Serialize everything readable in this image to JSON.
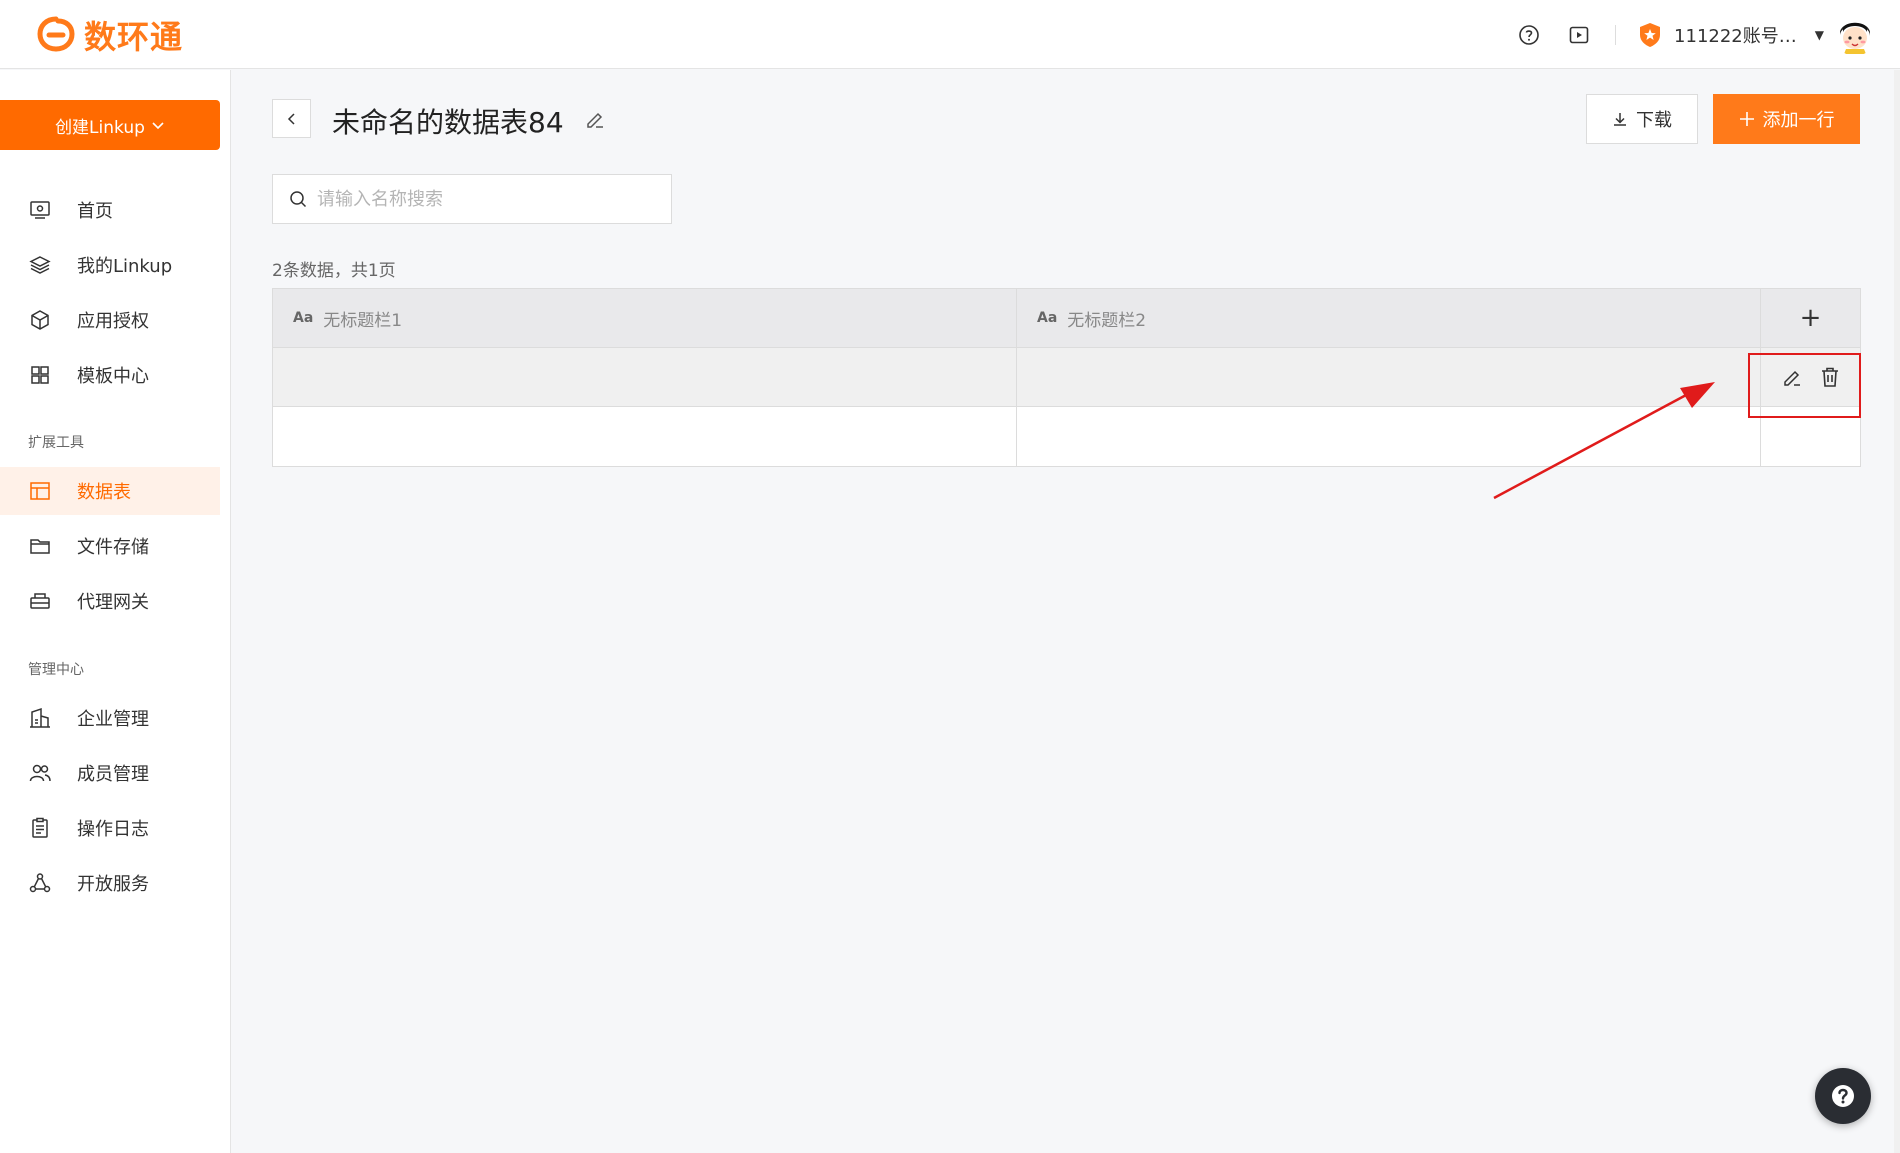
{
  "header": {
    "logo_text": "数环通",
    "account_name": "111222账号…",
    "brand_color": "#ff6a00"
  },
  "sidebar": {
    "create_label": "创建Linkup",
    "items": [
      {
        "label": "首页",
        "icon": "monitor-icon"
      },
      {
        "label": "我的Linkup",
        "icon": "layers-icon"
      },
      {
        "label": "应用授权",
        "icon": "cube-icon"
      },
      {
        "label": "模板中心",
        "icon": "grid-icon"
      }
    ],
    "section_tools": "扩展工具",
    "tools": [
      {
        "label": "数据表",
        "icon": "table-icon",
        "active": true
      },
      {
        "label": "文件存储",
        "icon": "folder-icon"
      },
      {
        "label": "代理网关",
        "icon": "gateway-icon"
      }
    ],
    "section_admin": "管理中心",
    "admin": [
      {
        "label": "企业管理",
        "icon": "building-icon"
      },
      {
        "label": "成员管理",
        "icon": "users-icon"
      },
      {
        "label": "操作日志",
        "icon": "clipboard-icon"
      },
      {
        "label": "开放服务",
        "icon": "share-icon"
      }
    ]
  },
  "main": {
    "title": "未命名的数据表84",
    "download_label": "下载",
    "add_row_label": "添加一行",
    "search_placeholder": "请输入名称搜索",
    "count_text": "2条数据，共1页",
    "table": {
      "columns": [
        {
          "type_icon": "Aa",
          "label": "无标题栏1"
        },
        {
          "type_icon": "Aa",
          "label": "无标题栏2"
        }
      ],
      "add_column_symbol": "+",
      "rows": [
        [
          "",
          ""
        ],
        [
          "",
          ""
        ]
      ]
    }
  },
  "annotation": {
    "highlight_color": "#e01b1b"
  }
}
